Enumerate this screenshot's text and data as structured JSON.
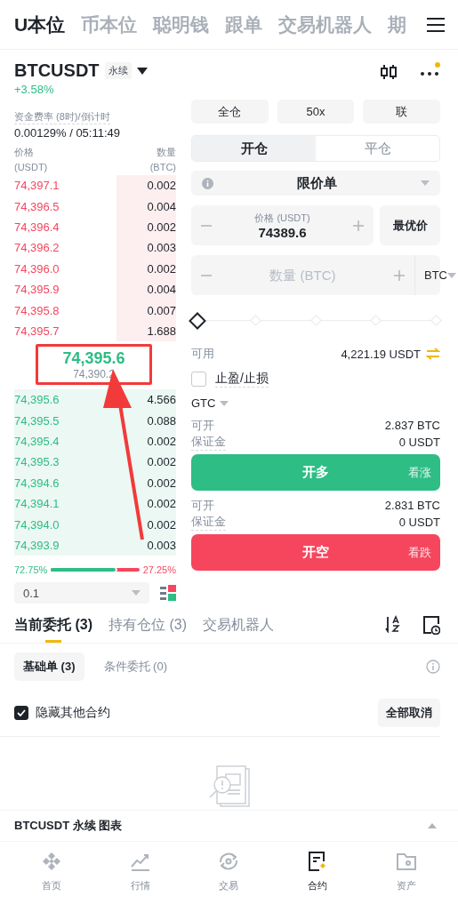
{
  "top_tabs": [
    {
      "label": "U本位",
      "selected": true
    },
    {
      "label": "币本位",
      "selected": false
    },
    {
      "label": "聪明钱",
      "selected": false
    },
    {
      "label": "跟单",
      "selected": false
    },
    {
      "label": "交易机器人",
      "selected": false
    },
    {
      "label": "期",
      "selected": false
    }
  ],
  "symbol": {
    "name": "BTCUSDT",
    "tag": "永续",
    "change": "+3.58%",
    "notification": true
  },
  "funding": {
    "label": "资金费率 (8时)/倒计时",
    "value": "0.00129% / 05:11:49"
  },
  "orderbook": {
    "price_header": "价格",
    "price_unit": "(USDT)",
    "qty_header": "数量",
    "qty_unit": "(BTC)",
    "asks": [
      {
        "price": "74,397.1",
        "qty": "0.002"
      },
      {
        "price": "74,396.5",
        "qty": "0.004"
      },
      {
        "price": "74,396.4",
        "qty": "0.002"
      },
      {
        "price": "74,396.2",
        "qty": "0.003"
      },
      {
        "price": "74,396.0",
        "qty": "0.002"
      },
      {
        "price": "74,395.9",
        "qty": "0.004"
      },
      {
        "price": "74,395.8",
        "qty": "0.007"
      },
      {
        "price": "74,395.7",
        "qty": "1.688"
      }
    ],
    "last_price": "74,395.6",
    "mark_price": "74,390.2",
    "bids": [
      {
        "price": "74,395.6",
        "qty": "4.566"
      },
      {
        "price": "74,395.5",
        "qty": "0.088"
      },
      {
        "price": "74,395.4",
        "qty": "0.002"
      },
      {
        "price": "74,395.3",
        "qty": "0.002"
      },
      {
        "price": "74,394.6",
        "qty": "0.002"
      },
      {
        "price": "74,394.1",
        "qty": "0.002"
      },
      {
        "price": "74,394.0",
        "qty": "0.002"
      },
      {
        "price": "74,393.9",
        "qty": "0.003"
      }
    ],
    "buy_ratio": "72.75%",
    "sell_ratio": "27.25%",
    "level": 0.7275,
    "precision": "0.1"
  },
  "annotation": {
    "kind": "box-and-arrow"
  },
  "trade": {
    "margin_mode": "全仓",
    "leverage": "50x",
    "asset_mode": "联",
    "sides": [
      {
        "label": "开仓",
        "selected": true
      },
      {
        "label": "平仓",
        "selected": false
      }
    ],
    "order_type": "限价单",
    "price_field": {
      "label": "价格 (USDT)",
      "value": "74389.6"
    },
    "best_price": "最优价",
    "qty_field": {
      "placeholder": "数量 (BTC)"
    },
    "qty_unit": "BTC",
    "slider": {
      "level": 0
    },
    "available": {
      "label": "可用",
      "value": "4,221.19 USDT"
    },
    "tpsl": {
      "label": "止盈/止损",
      "checked": false
    },
    "tif": "GTC",
    "actions": [
      {
        "kind": "long",
        "open_label": "可开",
        "open_value": "2.837 BTC",
        "margin_label": "保证金",
        "margin_value": "0 USDT",
        "button": "开多",
        "hint": "看涨"
      },
      {
        "kind": "short",
        "open_label": "可开",
        "open_value": "2.831 BTC",
        "margin_label": "保证金",
        "margin_value": "0 USDT",
        "button": "开空",
        "hint": "看跌"
      }
    ]
  },
  "orders": {
    "tabs": [
      {
        "label": "当前委托 (3)",
        "selected": true
      },
      {
        "label": "持有仓位 (3)",
        "selected": false
      },
      {
        "label": "交易机器人",
        "selected": false
      }
    ],
    "subtabs": [
      {
        "label": "基础单 (3)",
        "selected": true
      },
      {
        "label": "条件委托 (0)",
        "selected": false
      }
    ],
    "hide_other": {
      "label": "隐藏其他合约",
      "checked": true
    },
    "cancel_all": "全部取消"
  },
  "chart_bar": {
    "title": "BTCUSDT 永续 图表"
  },
  "nav": [
    {
      "kind": "home",
      "label": "首页",
      "selected": false
    },
    {
      "kind": "markets",
      "label": "行情",
      "selected": false
    },
    {
      "kind": "trade",
      "label": "交易",
      "selected": false
    },
    {
      "kind": "futures",
      "label": "合约",
      "selected": true
    },
    {
      "kind": "assets",
      "label": "资产",
      "selected": false
    }
  ]
}
